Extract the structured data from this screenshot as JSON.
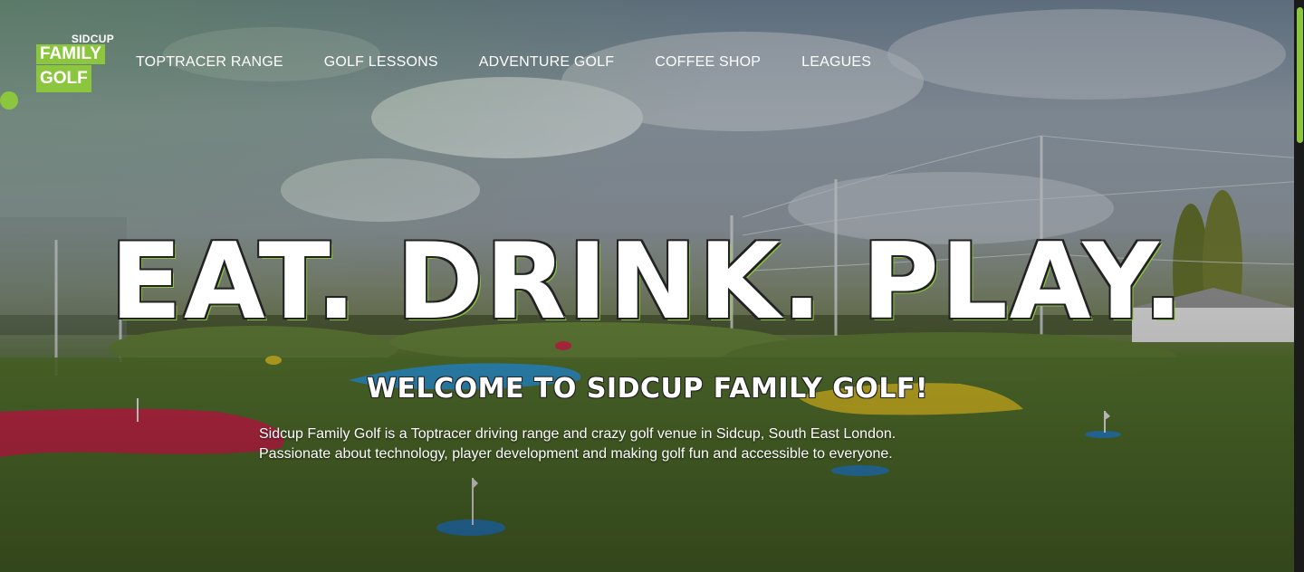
{
  "logo": {
    "line1": "SIDCUP",
    "line2": "FAMILY",
    "line3": "GOLF"
  },
  "nav": {
    "items": [
      {
        "label": "TOPTRACER RANGE"
      },
      {
        "label": "GOLF LESSONS"
      },
      {
        "label": "ADVENTURE GOLF"
      },
      {
        "label": "COFFEE SHOP"
      },
      {
        "label": "LEAGUES"
      }
    ]
  },
  "hero": {
    "headline": "EAT. DRINK. PLAY.",
    "subhead": "WELCOME TO SIDCUP FAMILY GOLF!",
    "description_line1": "Sidcup Family Golf is a Toptracer driving range and crazy golf venue in Sidcup, South East London.",
    "description_line2": "Passionate about technology, player development and making golf fun and accessible to everyone."
  },
  "colors": {
    "brand_green": "#8cc63f",
    "text": "#ffffff"
  },
  "icons": {
    "scroll_indicator": "green-dot-icon"
  }
}
